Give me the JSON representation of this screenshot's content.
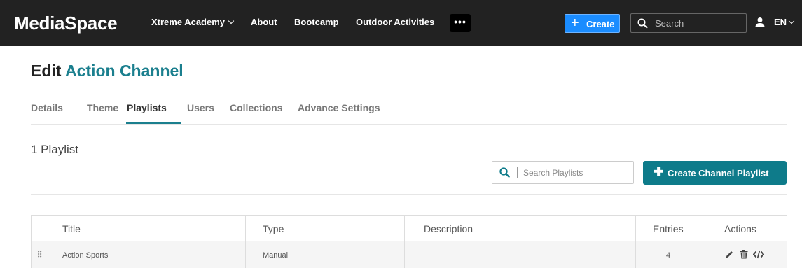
{
  "header": {
    "logo": "MediaSpace",
    "nav": [
      {
        "label": "Xtreme Academy"
      },
      {
        "label": "About"
      },
      {
        "label": "Bootcamp"
      },
      {
        "label": "Outdoor Activities"
      }
    ],
    "more_label": "•••",
    "create_label": "Create",
    "search_placeholder": "Search",
    "language": "EN"
  },
  "page": {
    "title_prefix": "Edit",
    "title_channel": "Action Channel"
  },
  "tabs": [
    {
      "label": "Details"
    },
    {
      "label": "Theme"
    },
    {
      "label": "Playlists",
      "active": true
    },
    {
      "label": "Users"
    },
    {
      "label": "Collections"
    },
    {
      "label": "Advance Settings"
    }
  ],
  "playlists": {
    "count_label": "1 Playlist",
    "search_placeholder": "Search Playlists",
    "create_button": "Create Channel Playlist"
  },
  "table": {
    "columns": [
      "Title",
      "Type",
      "Description",
      "Entries",
      "Actions"
    ],
    "rows": [
      {
        "title": "Action Sports",
        "type": "Manual",
        "description": "",
        "entries": "4"
      }
    ]
  },
  "colors": {
    "accent": "#1b7f8e",
    "topbar": "#222222",
    "create_blue": "#1a8cff"
  },
  "icons": [
    "chevron-down-icon",
    "search-icon",
    "user-icon",
    "plus-icon",
    "drag-handle-icon",
    "pencil-icon",
    "trash-icon",
    "code-icon"
  ]
}
